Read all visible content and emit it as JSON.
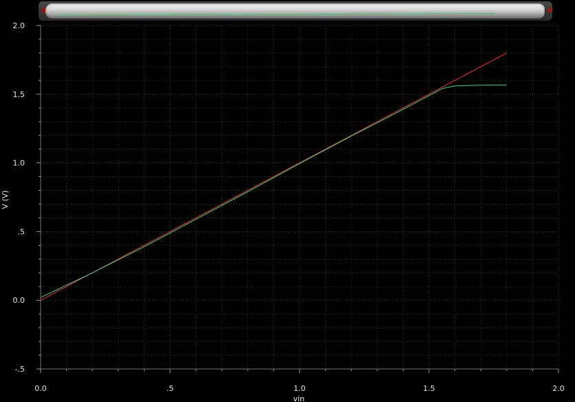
{
  "chart_data": {
    "type": "line",
    "xlabel": "vin",
    "ylabel": "V (V)",
    "xlim": [
      0.0,
      2.0
    ],
    "ylim": [
      -0.5,
      2.0
    ],
    "x_ticks": [
      "0.0",
      ".5",
      "1.0",
      "1.5",
      "2.0"
    ],
    "x_tick_values": [
      0.0,
      0.5,
      1.0,
      1.5,
      2.0
    ],
    "y_ticks": [
      "-.5",
      "0.0",
      ".5",
      "1.0",
      "1.5",
      "2.0"
    ],
    "y_tick_values": [
      -0.5,
      0.0,
      0.5,
      1.0,
      1.5,
      2.0
    ],
    "grid": true,
    "background": "#000000",
    "series": [
      {
        "color": "#ff2a2a",
        "x": [
          0.0,
          1.8
        ],
        "y": [
          0.0,
          1.8
        ]
      },
      {
        "color": "#2fe07a",
        "x": [
          0.0,
          0.2,
          0.4,
          0.6,
          0.8,
          1.0,
          1.2,
          1.4,
          1.45,
          1.5,
          1.52,
          1.55,
          1.6,
          1.7,
          1.8
        ],
        "y": [
          0.02,
          0.2,
          0.39,
          0.59,
          0.79,
          0.995,
          1.195,
          1.39,
          1.44,
          1.49,
          1.51,
          1.54,
          1.56,
          1.565,
          1.565
        ]
      }
    ]
  },
  "colors": {
    "grid": "#3a3a3a",
    "axis_text": "#e6e6e6",
    "scroll_arrow": "#d40000"
  }
}
